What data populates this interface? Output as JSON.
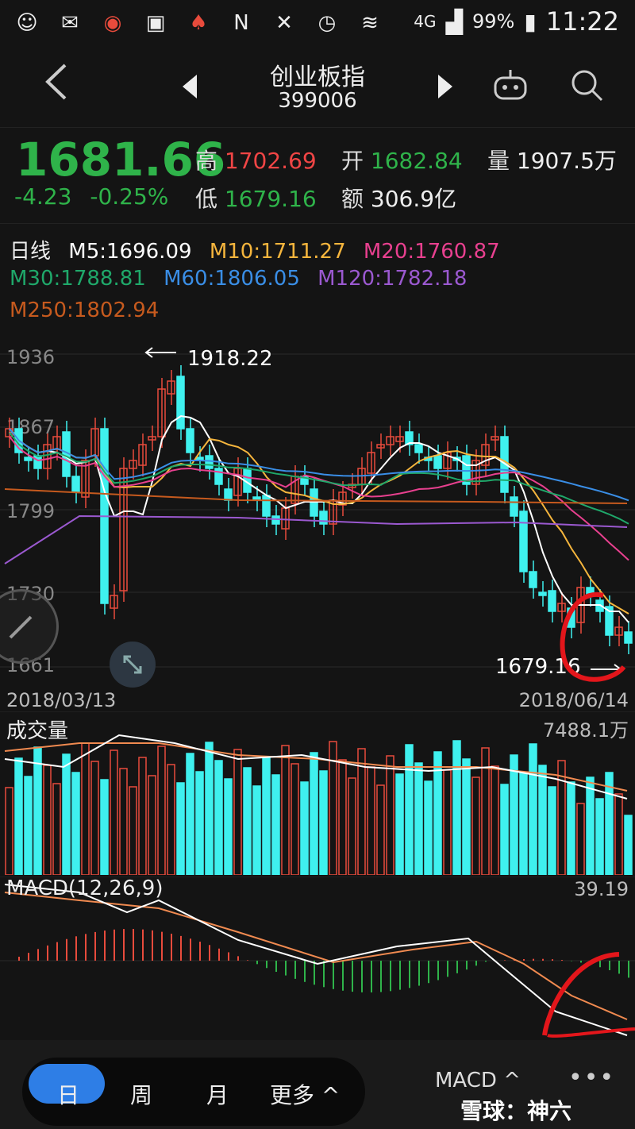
{
  "status": {
    "network": "4G",
    "battery": "99%",
    "time": "11:22"
  },
  "nav": {
    "title": "创业板指",
    "code": "399006"
  },
  "quote": {
    "price": "1681.66",
    "change": "-4.23",
    "change_pct": "-0.25%",
    "high_label": "高",
    "high": "1702.69",
    "open_label": "开",
    "open": "1682.84",
    "volume_label": "量",
    "volume": "1907.5万",
    "low_label": "低",
    "low": "1679.16",
    "amount_label": "额",
    "amount": "306.9亿"
  },
  "ma": {
    "period": "日线",
    "m5": "M5:1696.09",
    "m10": "M10:1711.27",
    "m20": "M20:1760.87",
    "m30": "M30:1788.81",
    "m60": "M60:1806.05",
    "m120": "M120:1782.18",
    "m250": "M250:1802.94",
    "colors": {
      "m5": "#ffffff",
      "m10": "#f5b53d",
      "m20": "#e8408f",
      "m30": "#1fa86a",
      "m60": "#3a8ee6",
      "m120": "#9b59d0",
      "m250": "#c65a1e"
    }
  },
  "kline": {
    "y_ticks": [
      "1936",
      "1867",
      "1799",
      "1730",
      "1661"
    ],
    "high_annotation": "1918.22",
    "low_annotation": "1679.16",
    "start_date": "2018/03/13",
    "end_date": "2018/06/14"
  },
  "volume": {
    "label": "成交量",
    "max": "7488.1万"
  },
  "macd": {
    "label": "MACD(12,26,9)",
    "max": "39.19"
  },
  "bottom": {
    "periods": [
      "日",
      "周",
      "月",
      "更多 ^"
    ],
    "indicator": "MACD ^",
    "more": "•••"
  },
  "watermark": "雪球：神六"
}
